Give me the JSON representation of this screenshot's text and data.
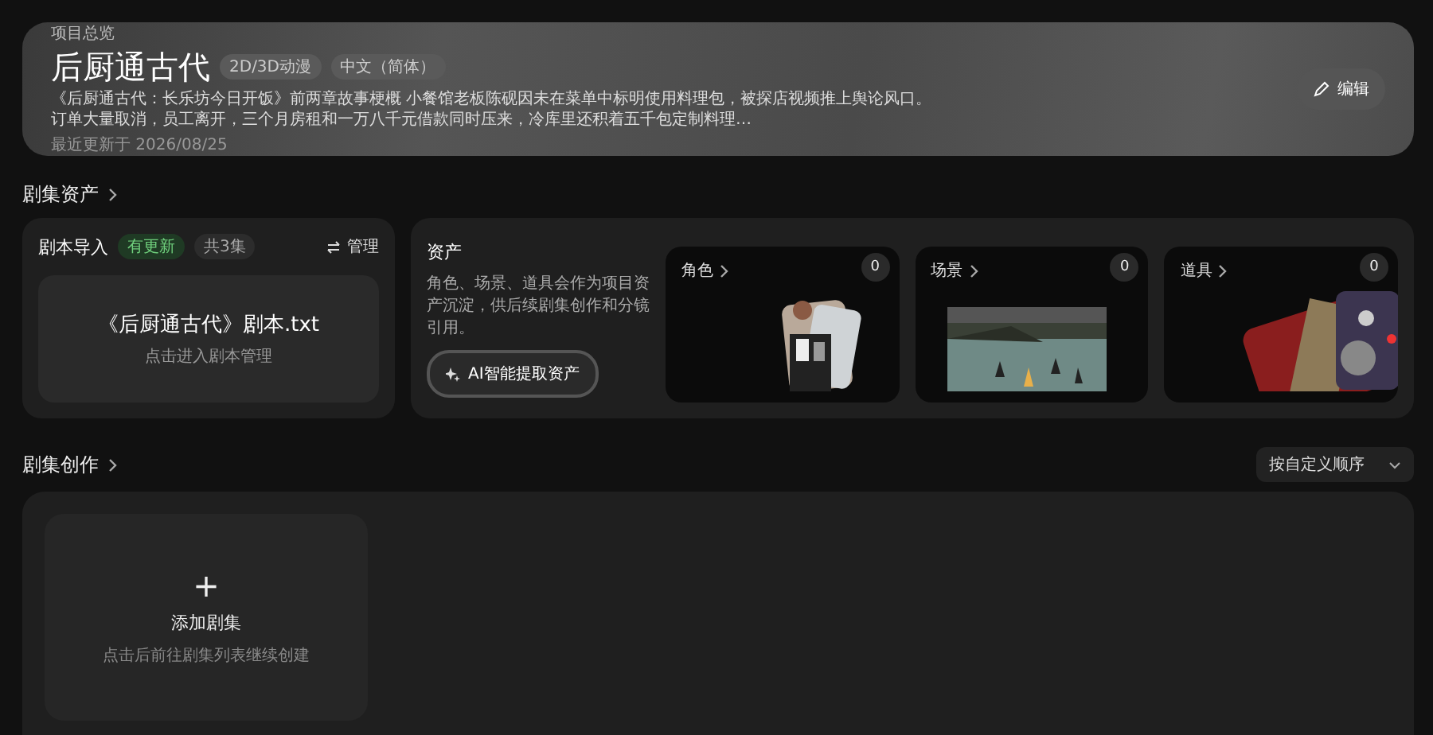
{
  "overview": {
    "eyebrow": "项目总览",
    "title": "后厨通古代",
    "tags": [
      "2D/3D动漫",
      "中文（简体）"
    ],
    "description": "《后厨通古代：长乐坊今日开饭》前两章故事梗概 小餐馆老板陈砚因未在菜单中标明使用料理包，被探店视频推上舆论风口。订单大量取消，员工离开，三个月房租和一万八千元借款同时压来，冷库里还积着五千包定制料理…",
    "updated": "最近更新于 2026/08/25",
    "edit_button": "编辑"
  },
  "assets_section": {
    "heading": "剧集资产",
    "script_import": {
      "title": "剧本导入",
      "badges": [
        {
          "label": "有更新",
          "kind": "highlight"
        },
        {
          "label": "共3集",
          "kind": "plain"
        }
      ],
      "manage_button": "管理",
      "file_name": "《后厨通古代》剧本.txt",
      "file_hint": "点击进入剧本管理"
    },
    "assets": {
      "title": "资产",
      "description": "角色、场景、道具会作为项目资产沉淀，供后续剧集创作和分镜引用。",
      "ai_button": "AI智能提取资产",
      "categories": [
        {
          "label": "角色",
          "count": "0",
          "kind": "picture"
        },
        {
          "label": "场景",
          "count": "0",
          "kind": "picture"
        },
        {
          "label": "道具",
          "count": "0",
          "kind": "picture"
        }
      ]
    }
  },
  "creation_section": {
    "heading": "剧集创作",
    "sort_select": "按自定义顺序",
    "add_card": {
      "plus": "+",
      "title": "添加剧集",
      "hint": "点击后前往剧集列表继续创建"
    }
  }
}
